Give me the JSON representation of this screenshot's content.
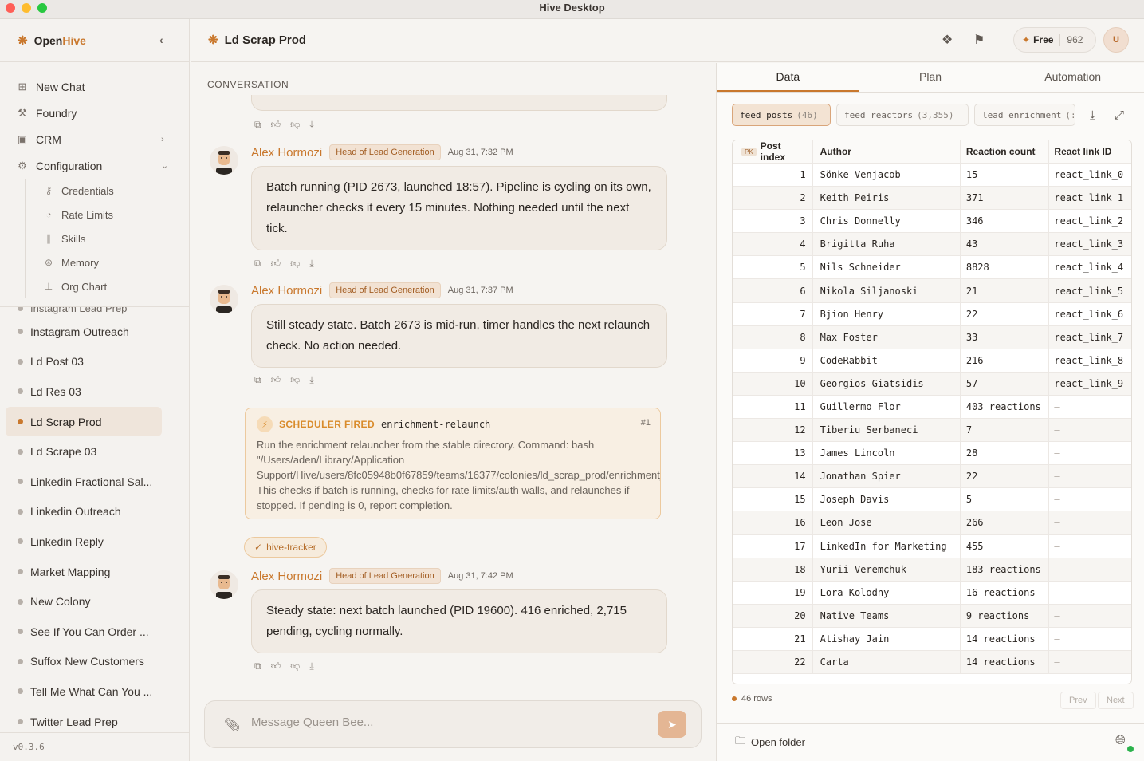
{
  "window": {
    "title": "Hive Desktop"
  },
  "sidebar": {
    "brand_open": "Open",
    "brand_hive": "Hive",
    "nav": [
      {
        "label": "New Chat",
        "icon": "new-chat-icon"
      },
      {
        "label": "Foundry",
        "icon": "hammer-icon"
      },
      {
        "label": "CRM",
        "icon": "contacts-icon"
      },
      {
        "label": "Configuration",
        "icon": "gear-icon"
      }
    ],
    "config_items": [
      {
        "label": "Credentials",
        "icon": "key-icon"
      },
      {
        "label": "Rate Limits",
        "icon": "gauge-icon"
      },
      {
        "label": "Skills",
        "icon": "books-icon"
      },
      {
        "label": "Memory",
        "icon": "brain-icon"
      },
      {
        "label": "Org Chart",
        "icon": "org-chart-icon"
      }
    ],
    "colonies_partial": "Instagram Lead Prep",
    "colonies": [
      "Instagram Outreach",
      "Ld Post 03",
      "Ld Res 03",
      "Ld Scrap Prod",
      "Ld Scrape 03",
      "Linkedin Fractional Sal...",
      "Linkedin Outreach",
      "Linkedin Reply",
      "Market Mapping",
      "New Colony",
      "See If You Can Order ...",
      "Suffox New Customers",
      "Tell Me What Can You ...",
      "Twitter Lead Prep"
    ],
    "active_colony": "Ld Scrap Prod",
    "version": "v0.3.6"
  },
  "header": {
    "title": "Ld Scrap Prod",
    "plan_label": "Free",
    "plan_count": "962",
    "avatar_initial": "U"
  },
  "conversation": {
    "label": "CONVERSATION",
    "messages": [
      {
        "name": "Alex Hormozi",
        "role": "Head of Lead Generation",
        "time": "Aug 31, 7:32 PM",
        "text": "Batch running (PID 2673, launched 18:57). Pipeline is cycling on its own, relauncher checks it every 15 minutes. Nothing needed until the next tick."
      },
      {
        "name": "Alex Hormozi",
        "role": "Head of Lead Generation",
        "time": "Aug 31, 7:37 PM",
        "text": "Still steady state. Batch 2673 is mid-run, timer handles the next relaunch check. No action needed."
      },
      {
        "name": "Alex Hormozi",
        "role": "Head of Lead Generation",
        "time": "Aug 31, 7:42 PM",
        "text": "Steady state: next batch launched (PID 19600). 416 enriched, 2,715 pending, cycling normally."
      }
    ],
    "scheduler": {
      "label": "SCHEDULER FIRED",
      "command": "enrichment-relaunch",
      "number": "#1",
      "body": "Run the enrichment relauncher from the stable directory. Command: bash\n\"/Users/aden/Library/Application\nSupport/Hive/users/8fc05948b0f67859/teams/16377/colonies/ld_scrap_prod/enrichment_scripts/re\nThis checks if batch is running, checks for rate limits/auth walls, and relaunches if\nstopped. If pending is 0, report completion."
    },
    "tracker": "hive-tracker",
    "composer_placeholder": "Message Queen Bee..."
  },
  "panel": {
    "tabs": [
      "Data",
      "Plan",
      "Automation"
    ],
    "active_tab": "Data",
    "datasets": [
      {
        "name": "feed_posts",
        "count": "(46)"
      },
      {
        "name": "feed_reactors",
        "count": "(3,355)"
      },
      {
        "name": "lead_enrichment",
        "count": "(:"
      }
    ],
    "columns": {
      "pk": "PK",
      "index": "Post index",
      "author": "Author",
      "reactions": "Reaction count",
      "link": "React link ID"
    },
    "rows": [
      [
        "1",
        "Sönke Venjacob",
        "15",
        "react_link_0"
      ],
      [
        "2",
        "Keith Peiris",
        "371",
        "react_link_1"
      ],
      [
        "3",
        "Chris Donnelly",
        "346",
        "react_link_2"
      ],
      [
        "4",
        "Brigitta Ruha",
        "43",
        "react_link_3"
      ],
      [
        "5",
        "Nils Schneider",
        "8828",
        "react_link_4"
      ],
      [
        "6",
        "Nikola Siljanoski",
        "21",
        "react_link_5"
      ],
      [
        "7",
        "Bjion Henry",
        "22",
        "react_link_6"
      ],
      [
        "8",
        "Max Foster",
        "33",
        "react_link_7"
      ],
      [
        "9",
        "CodeRabbit",
        "216",
        "react_link_8"
      ],
      [
        "10",
        "Georgios Giatsidis",
        "57",
        "react_link_9"
      ],
      [
        "11",
        "Guillermo Flor",
        "403 reactions",
        "—"
      ],
      [
        "12",
        "Tiberiu Serbaneci",
        "7",
        "—"
      ],
      [
        "13",
        "James Lincoln",
        "28",
        "—"
      ],
      [
        "14",
        "Jonathan Spier",
        "22",
        "—"
      ],
      [
        "15",
        "Joseph Davis",
        "5",
        "—"
      ],
      [
        "16",
        "Leon Jose",
        "266",
        "—"
      ],
      [
        "17",
        "LinkedIn for Marketing",
        "455",
        "—"
      ],
      [
        "18",
        "Yurii Veremchuk",
        "183 reactions",
        "—"
      ],
      [
        "19",
        "Lora Kolodny",
        "16 reactions",
        "—"
      ],
      [
        "20",
        "Native Teams",
        "9 reactions",
        "—"
      ],
      [
        "21",
        "Atishay Jain",
        "14 reactions",
        "—"
      ],
      [
        "22",
        "Carta",
        "14 reactions",
        "—"
      ]
    ],
    "row_count": "46 rows",
    "prev": "Prev",
    "next": "Next",
    "open_folder": "Open folder"
  }
}
